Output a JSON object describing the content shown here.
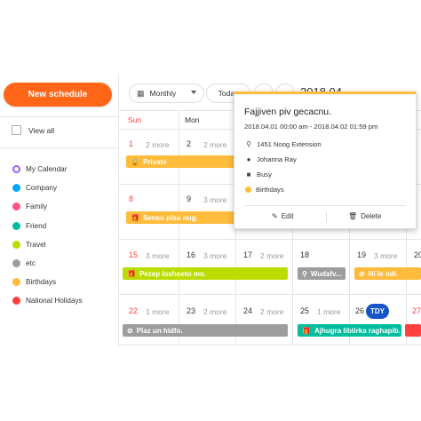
{
  "sidebar": {
    "new_schedule": "New schedule",
    "view_all": "View all",
    "calendars": [
      {
        "label": "My Calendar",
        "color": "#9e5fff",
        "outline": true
      },
      {
        "label": "Company",
        "color": "#00a9ff"
      },
      {
        "label": "Family",
        "color": "#ff5583"
      },
      {
        "label": "Friend",
        "color": "#03bd9e"
      },
      {
        "label": "Travel",
        "color": "#bbdc00"
      },
      {
        "label": "etc",
        "color": "#9d9d9d"
      },
      {
        "label": "Birthdays",
        "color": "#ffbb3b"
      },
      {
        "label": "National Holidays",
        "color": "#ff4040"
      }
    ]
  },
  "toolbar": {
    "view": "Monthly",
    "today": "Today",
    "prev": "‹",
    "next": "›",
    "range": "2018.04"
  },
  "days": [
    "Sun",
    "Mon"
  ],
  "weeks": [
    {
      "dates": [
        "1",
        "2"
      ],
      "more": [
        "2 more",
        "2 more"
      ]
    },
    {
      "dates": [
        "8",
        "9"
      ],
      "more": [
        "",
        "3 more"
      ]
    },
    {
      "dates": [
        "15",
        "16",
        "17",
        "18",
        "19",
        "20"
      ],
      "more": [
        "3 more",
        "3 more",
        "2 more",
        "",
        "3 more",
        ""
      ]
    },
    {
      "dates": [
        "22",
        "23",
        "24",
        "25",
        "26",
        "27"
      ],
      "more": [
        "1 more",
        "2 more",
        "2 more",
        "1 more",
        "",
        ""
      ]
    }
  ],
  "today_badge": "TDY",
  "events": {
    "private": "Private",
    "sensu": "Sensu pisu nug.",
    "pezep": "Pezep loshoeto mo.",
    "wudafv": "Wudafv...",
    "hi_le": "Hi le odi.",
    "plaz": "Plaz un hidfo.",
    "ajhugra": "Ajhugra libtirka raghapib."
  },
  "event_colors": {
    "birthdays": "#ffbb3b",
    "travel": "#bbdc00",
    "etc": "#9d9d9d",
    "friend": "#03bd9e",
    "holiday": "#ff4040"
  },
  "popup": {
    "title": "Fajjiven piv gecacnu.",
    "time": "2018.04.01 00:00 am - 2018.04.02 01:59 pm",
    "location": "1451 Noog Extension",
    "attendee": "Johanna Ray",
    "state": "Busy",
    "calendar": "Birthdays",
    "edit": "Edit",
    "delete": "Delete",
    "icons": [
      "location-icon",
      "person-icon",
      "lock-icon",
      "pencil-icon",
      "trash-icon"
    ]
  }
}
